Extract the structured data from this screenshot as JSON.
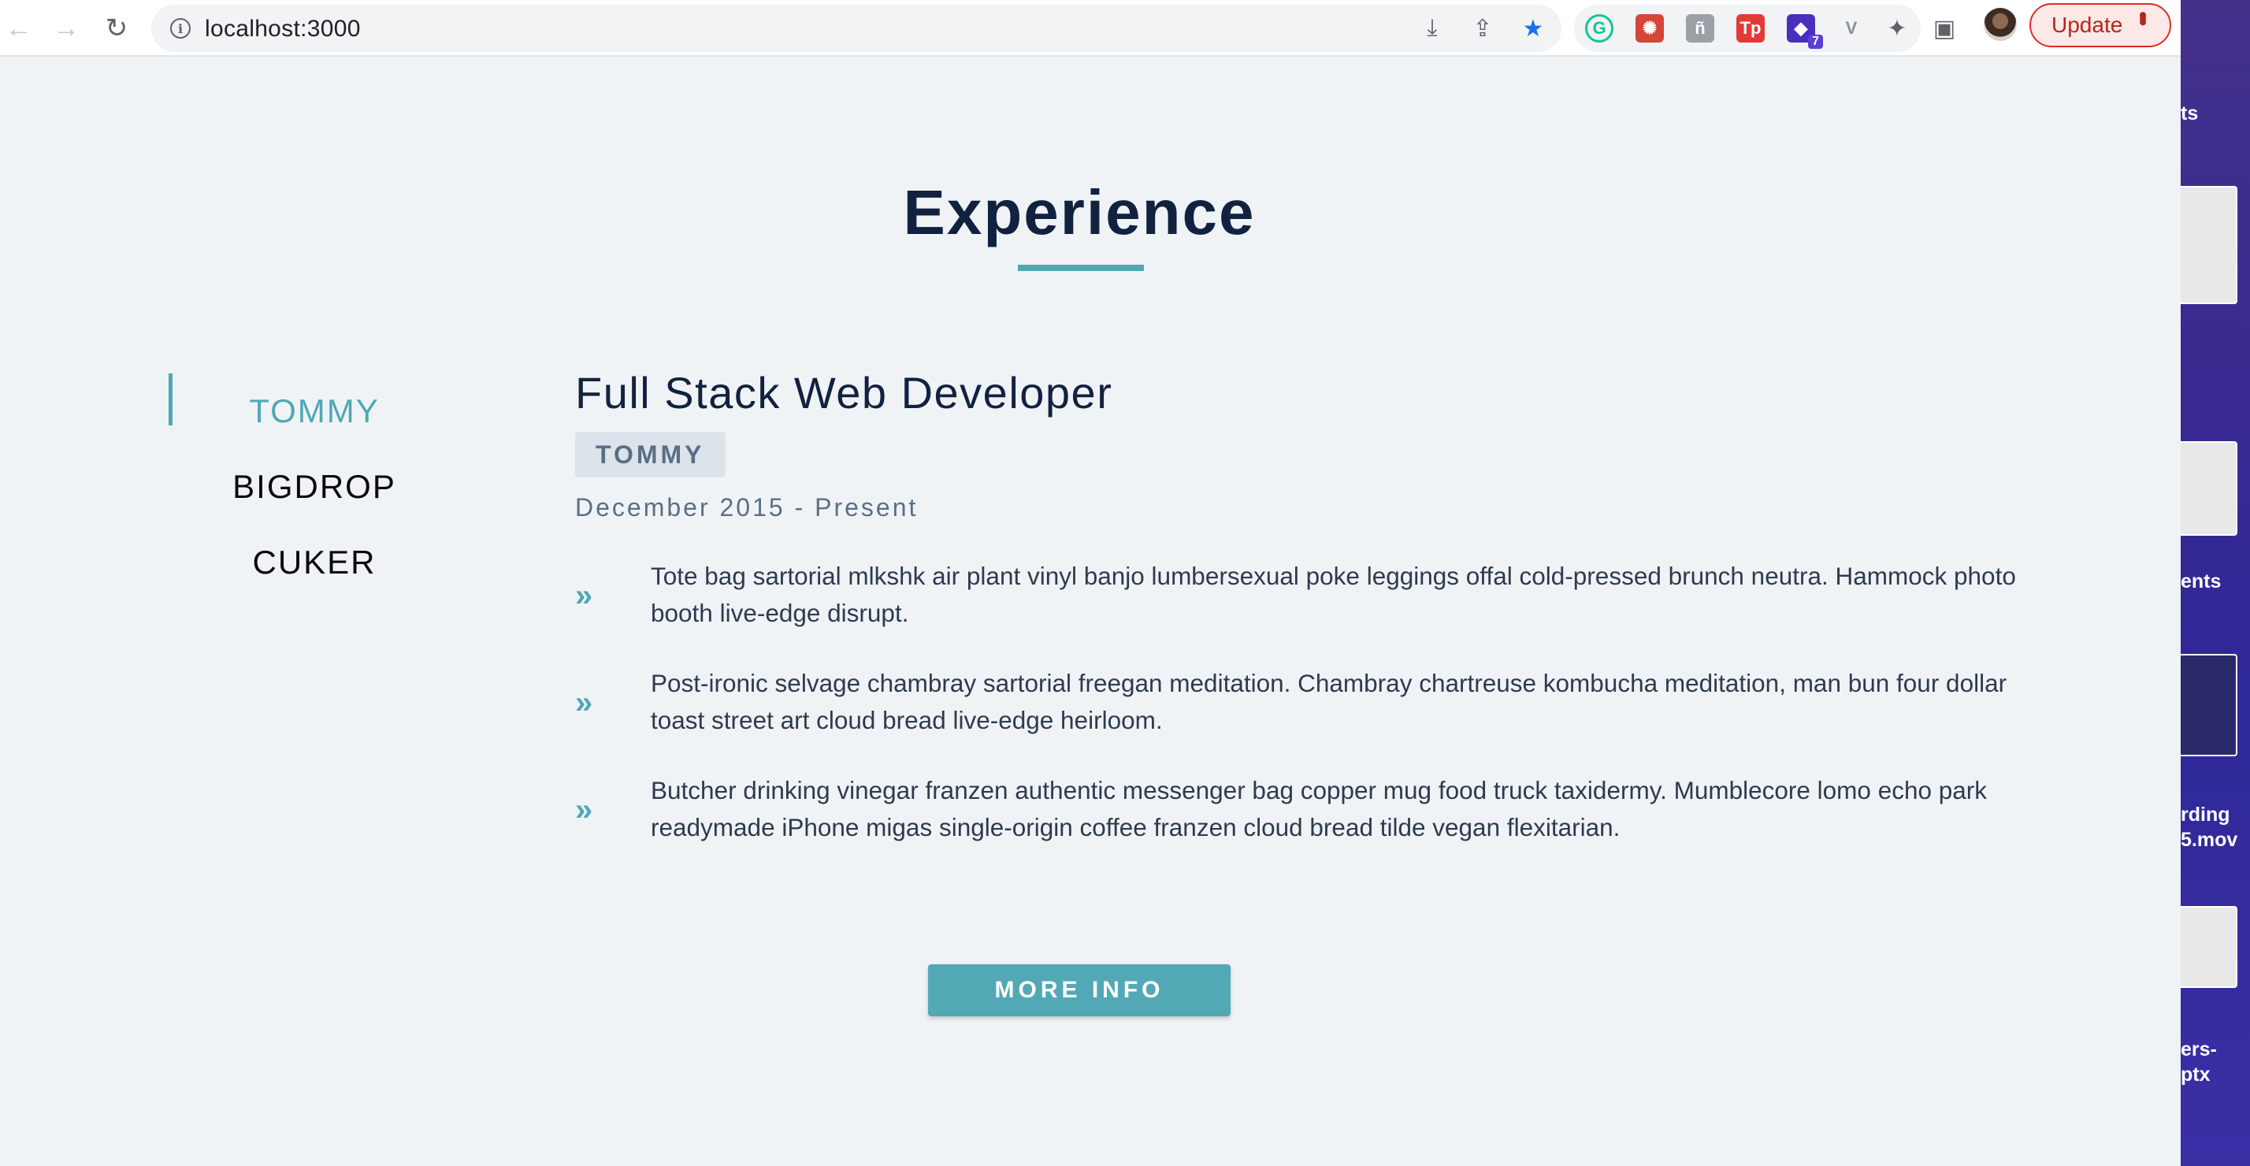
{
  "browser": {
    "url": "localhost:3000",
    "update_label": "Update",
    "back_icon": "←",
    "forward_icon": "→",
    "reload_icon": "↻",
    "info_icon": "i",
    "install_icon": "⤓",
    "share_icon": "⇪",
    "bookmark_star": "★",
    "extensions_icon": "✦",
    "sidepanel_icon": "▣",
    "extension_badge": "7",
    "extensions": [
      {
        "name": "grammarly-extension-icon",
        "glyph": "G",
        "color": "#15c39a"
      },
      {
        "name": "red-extension-icon",
        "glyph": "✺",
        "color": "#d44638"
      },
      {
        "name": "grey-extension-icon",
        "glyph": "ñ",
        "color": "#9aa0a6"
      },
      {
        "name": "tp-extension-icon",
        "glyph": "Tp",
        "color": "#e53935"
      },
      {
        "name": "purple-extension-icon",
        "glyph": "◆",
        "color": "#4a2fbd"
      },
      {
        "name": "vue-devtools-icon",
        "glyph": "V",
        "color": "#8a9099"
      }
    ]
  },
  "page": {
    "section_title": "Experience",
    "tabs": [
      {
        "label": "TOMMY",
        "active": true
      },
      {
        "label": "BIGDROP",
        "active": false
      },
      {
        "label": "CUKER",
        "active": false
      }
    ],
    "job": {
      "title": "Full Stack Web Developer",
      "company": "TOMMY",
      "range": "December 2015 - Present",
      "duty_icon": "»",
      "duties": [
        "Tote bag sartorial mlkshk air plant vinyl banjo lumbersexual poke leggings offal cold-pressed brunch neutra. Hammock photo booth live-edge disrupt.",
        "Post-ironic selvage chambray sartorial freegan meditation. Chambray chartreuse kombucha meditation, man bun four dollar toast street art cloud bread live-edge heirloom.",
        "Butcher drinking vinegar franzen authentic messenger bag copper mug food truck taxidermy. Mumblecore lomo echo park readymade iPhone migas single-origin coffee franzen cloud bread tilde vegan flexitarian."
      ]
    },
    "more_info_label": "MORE INFO",
    "accent_color": "#4fa8b4",
    "heading_color": "#112240"
  },
  "desktop": {
    "labels": [
      "ts",
      "ents",
      "rding",
      "5.mov",
      "ers-",
      "ptx"
    ]
  }
}
